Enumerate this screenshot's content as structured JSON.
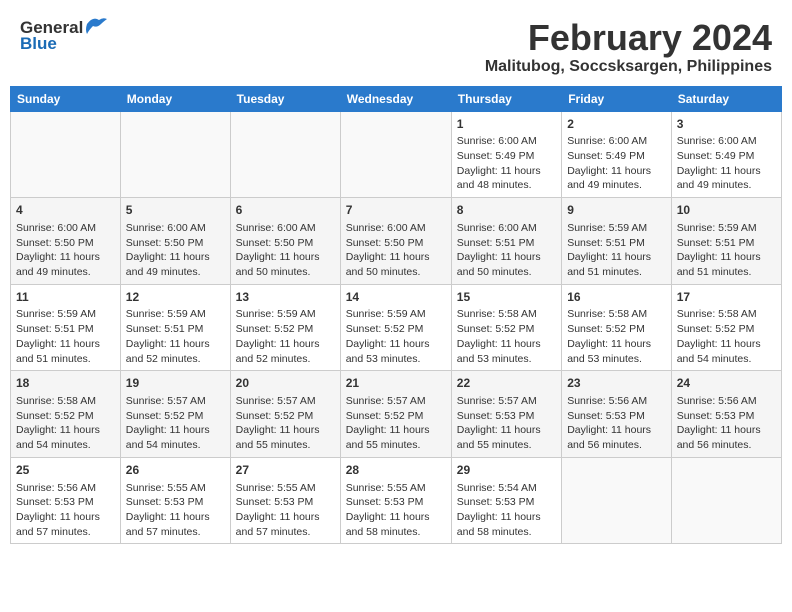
{
  "header": {
    "logo_general": "General",
    "logo_blue": "Blue",
    "title": "February 2024",
    "subtitle": "Malitubog, Soccsksargen, Philippines"
  },
  "weekdays": [
    "Sunday",
    "Monday",
    "Tuesday",
    "Wednesday",
    "Thursday",
    "Friday",
    "Saturday"
  ],
  "weeks": [
    [
      {
        "day": "",
        "info": ""
      },
      {
        "day": "",
        "info": ""
      },
      {
        "day": "",
        "info": ""
      },
      {
        "day": "",
        "info": ""
      },
      {
        "day": "1",
        "info": "Sunrise: 6:00 AM\nSunset: 5:49 PM\nDaylight: 11 hours\nand 48 minutes."
      },
      {
        "day": "2",
        "info": "Sunrise: 6:00 AM\nSunset: 5:49 PM\nDaylight: 11 hours\nand 49 minutes."
      },
      {
        "day": "3",
        "info": "Sunrise: 6:00 AM\nSunset: 5:49 PM\nDaylight: 11 hours\nand 49 minutes."
      }
    ],
    [
      {
        "day": "4",
        "info": "Sunrise: 6:00 AM\nSunset: 5:50 PM\nDaylight: 11 hours\nand 49 minutes."
      },
      {
        "day": "5",
        "info": "Sunrise: 6:00 AM\nSunset: 5:50 PM\nDaylight: 11 hours\nand 49 minutes."
      },
      {
        "day": "6",
        "info": "Sunrise: 6:00 AM\nSunset: 5:50 PM\nDaylight: 11 hours\nand 50 minutes."
      },
      {
        "day": "7",
        "info": "Sunrise: 6:00 AM\nSunset: 5:50 PM\nDaylight: 11 hours\nand 50 minutes."
      },
      {
        "day": "8",
        "info": "Sunrise: 6:00 AM\nSunset: 5:51 PM\nDaylight: 11 hours\nand 50 minutes."
      },
      {
        "day": "9",
        "info": "Sunrise: 5:59 AM\nSunset: 5:51 PM\nDaylight: 11 hours\nand 51 minutes."
      },
      {
        "day": "10",
        "info": "Sunrise: 5:59 AM\nSunset: 5:51 PM\nDaylight: 11 hours\nand 51 minutes."
      }
    ],
    [
      {
        "day": "11",
        "info": "Sunrise: 5:59 AM\nSunset: 5:51 PM\nDaylight: 11 hours\nand 51 minutes."
      },
      {
        "day": "12",
        "info": "Sunrise: 5:59 AM\nSunset: 5:51 PM\nDaylight: 11 hours\nand 52 minutes."
      },
      {
        "day": "13",
        "info": "Sunrise: 5:59 AM\nSunset: 5:52 PM\nDaylight: 11 hours\nand 52 minutes."
      },
      {
        "day": "14",
        "info": "Sunrise: 5:59 AM\nSunset: 5:52 PM\nDaylight: 11 hours\nand 53 minutes."
      },
      {
        "day": "15",
        "info": "Sunrise: 5:58 AM\nSunset: 5:52 PM\nDaylight: 11 hours\nand 53 minutes."
      },
      {
        "day": "16",
        "info": "Sunrise: 5:58 AM\nSunset: 5:52 PM\nDaylight: 11 hours\nand 53 minutes."
      },
      {
        "day": "17",
        "info": "Sunrise: 5:58 AM\nSunset: 5:52 PM\nDaylight: 11 hours\nand 54 minutes."
      }
    ],
    [
      {
        "day": "18",
        "info": "Sunrise: 5:58 AM\nSunset: 5:52 PM\nDaylight: 11 hours\nand 54 minutes."
      },
      {
        "day": "19",
        "info": "Sunrise: 5:57 AM\nSunset: 5:52 PM\nDaylight: 11 hours\nand 54 minutes."
      },
      {
        "day": "20",
        "info": "Sunrise: 5:57 AM\nSunset: 5:52 PM\nDaylight: 11 hours\nand 55 minutes."
      },
      {
        "day": "21",
        "info": "Sunrise: 5:57 AM\nSunset: 5:52 PM\nDaylight: 11 hours\nand 55 minutes."
      },
      {
        "day": "22",
        "info": "Sunrise: 5:57 AM\nSunset: 5:53 PM\nDaylight: 11 hours\nand 55 minutes."
      },
      {
        "day": "23",
        "info": "Sunrise: 5:56 AM\nSunset: 5:53 PM\nDaylight: 11 hours\nand 56 minutes."
      },
      {
        "day": "24",
        "info": "Sunrise: 5:56 AM\nSunset: 5:53 PM\nDaylight: 11 hours\nand 56 minutes."
      }
    ],
    [
      {
        "day": "25",
        "info": "Sunrise: 5:56 AM\nSunset: 5:53 PM\nDaylight: 11 hours\nand 57 minutes."
      },
      {
        "day": "26",
        "info": "Sunrise: 5:55 AM\nSunset: 5:53 PM\nDaylight: 11 hours\nand 57 minutes."
      },
      {
        "day": "27",
        "info": "Sunrise: 5:55 AM\nSunset: 5:53 PM\nDaylight: 11 hours\nand 57 minutes."
      },
      {
        "day": "28",
        "info": "Sunrise: 5:55 AM\nSunset: 5:53 PM\nDaylight: 11 hours\nand 58 minutes."
      },
      {
        "day": "29",
        "info": "Sunrise: 5:54 AM\nSunset: 5:53 PM\nDaylight: 11 hours\nand 58 minutes."
      },
      {
        "day": "",
        "info": ""
      },
      {
        "day": "",
        "info": ""
      }
    ]
  ]
}
